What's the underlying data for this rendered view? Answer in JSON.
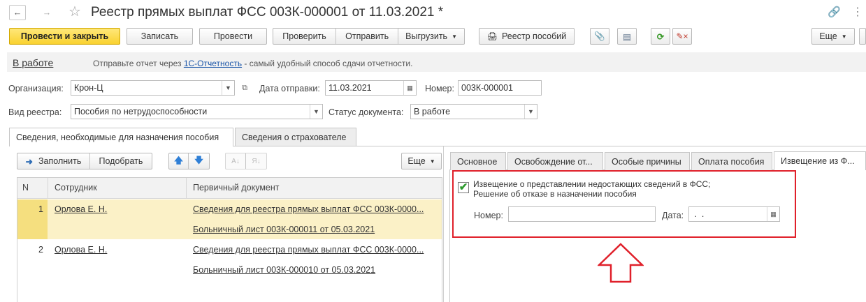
{
  "window": {
    "title": "Реестр прямых выплат ФСС 003К-000001 от 11.03.2021 *"
  },
  "toolbar": {
    "post_close": "Провести и закрыть",
    "save": "Записать",
    "post": "Провести",
    "check": "Проверить",
    "send": "Отправить",
    "unload": "Выгрузить",
    "registry_benefits": "Реестр пособий",
    "more": "Еще"
  },
  "status_bar": {
    "state": "В работе",
    "hint_prefix": "Отправьте отчет через ",
    "hint_link": "1С-Отчетность",
    "hint_suffix": " - самый удобный способ сдачи отчетности."
  },
  "form": {
    "org_label": "Организация:",
    "org_value": "Крон-Ц",
    "send_date_label": "Дата отправки:",
    "send_date_value": "11.03.2021",
    "number_label": "Номер:",
    "number_value": "003К-000001",
    "registry_type_label": "Вид реестра:",
    "registry_type_value": "Пособия по нетрудоспособности",
    "doc_status_label": "Статус документа:",
    "doc_status_value": "В работе"
  },
  "main_tabs": [
    {
      "label": "Сведения, необходимые для назначения пособия"
    },
    {
      "label": "Сведения о страхователе"
    }
  ],
  "grid_toolbar": {
    "fill": "Заполнить",
    "pick": "Подобрать",
    "more": "Еще"
  },
  "grid": {
    "columns": [
      "N",
      "Сотрудник",
      "Первичный документ"
    ],
    "rows": [
      {
        "n": "1",
        "employee": "Орлова Е. Н.",
        "doc1": "Сведения для реестра прямых выплат ФСС 003К-0000...",
        "doc2": "Больничный лист 003К-000011 от 05.03.2021"
      },
      {
        "n": "2",
        "employee": "Орлова Е. Н.",
        "doc1": "Сведения для реестра прямых выплат ФСС 003К-0000...",
        "doc2": "Больничный лист 003К-000010 от 05.03.2021"
      }
    ]
  },
  "right_tabs": [
    {
      "label": "Основное"
    },
    {
      "label": "Освобождение от..."
    },
    {
      "label": "Особые причины"
    },
    {
      "label": "Оплата пособия"
    },
    {
      "label": "Извещение из Ф..."
    }
  ],
  "notice": {
    "checkbox_label_1": "Извещение о представлении недостающих сведений в ФСС;",
    "checkbox_label_2": "Решение об отказе в назначении пособия",
    "number_label": "Номер:",
    "number_value": "",
    "date_label": "Дата:",
    "date_value": " .  .    "
  },
  "colors": {
    "accent_yellow": "#f9d230",
    "highlight_row": "#fbf1c7",
    "annotation_red": "#e0202a",
    "link_blue": "#1a55a8"
  }
}
